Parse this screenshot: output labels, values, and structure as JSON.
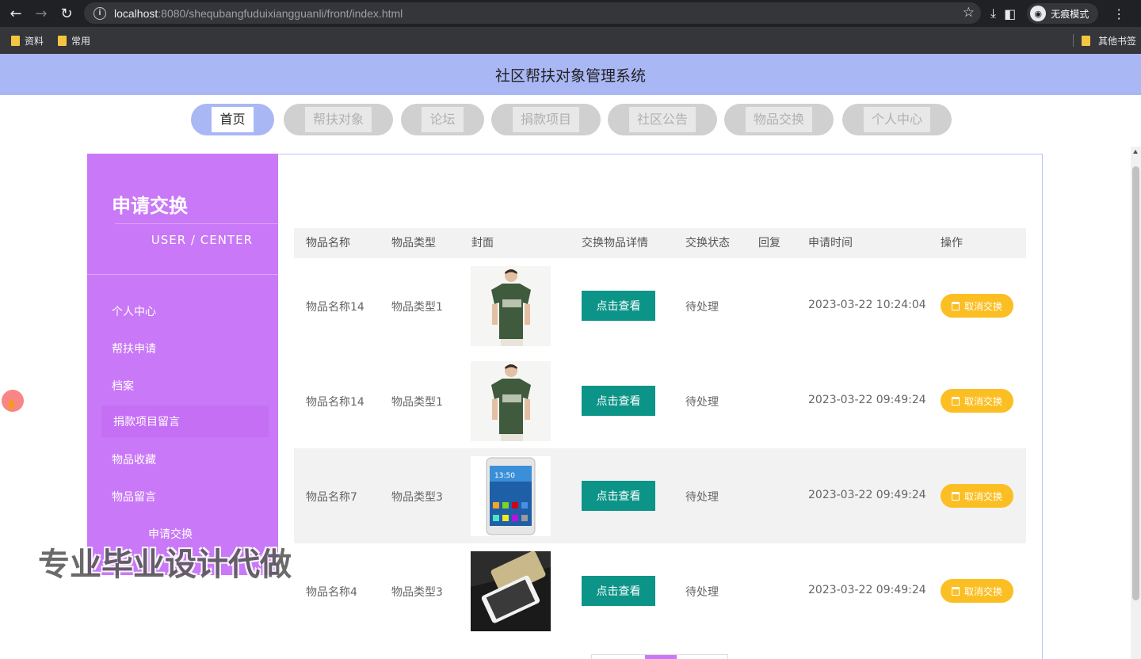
{
  "browser": {
    "url_host": "localhost",
    "url_rest": ":8080/shequbangfuduixiangguanli/front/index.html",
    "incognito_label": "无痕模式",
    "bookmarks": [
      "资料",
      "常用"
    ],
    "other_bookmarks": "其他书签"
  },
  "site": {
    "title": "社区帮扶对象管理系统"
  },
  "nav": {
    "items": [
      "首页",
      "帮扶对象",
      "论坛",
      "捐款项目",
      "社区公告",
      "物品交换",
      "个人中心"
    ],
    "active_index": 0
  },
  "sidebar": {
    "title": "申请交换",
    "subtitle": "USER / CENTER",
    "items": [
      "个人中心",
      "帮扶申请",
      "档案",
      "捐款项目留言",
      "物品收藏",
      "物品留言",
      "申请交换"
    ]
  },
  "table": {
    "headers": [
      "物品名称",
      "物品类型",
      "封面",
      "交换物品详情",
      "交换状态",
      "回复",
      "申请时间",
      "操作"
    ],
    "view_label": "点击查看",
    "cancel_label": "取消交换",
    "rows": [
      {
        "name": "物品名称14",
        "type": "物品类型1",
        "image": "green-tshirt",
        "status": "待处理",
        "reply": "",
        "time": "2023-03-22 10:24:04"
      },
      {
        "name": "物品名称14",
        "type": "物品类型1",
        "image": "green-tshirt",
        "status": "待处理",
        "reply": "",
        "time": "2023-03-22 09:49:24"
      },
      {
        "name": "物品名称7",
        "type": "物品类型3",
        "image": "smartphone-front",
        "status": "待处理",
        "reply": "",
        "time": "2023-03-22 09:49:24"
      },
      {
        "name": "物品名称4",
        "type": "物品类型3",
        "image": "phones-dark",
        "status": "待处理",
        "reply": "",
        "time": "2023-03-22 09:49:24"
      }
    ]
  },
  "watermark": "专业毕业设计代做",
  "colors": {
    "header": "#aab7f5",
    "sidebar": "#c978f7",
    "view_button": "#0d9488",
    "cancel_button": "#fbbf24"
  }
}
